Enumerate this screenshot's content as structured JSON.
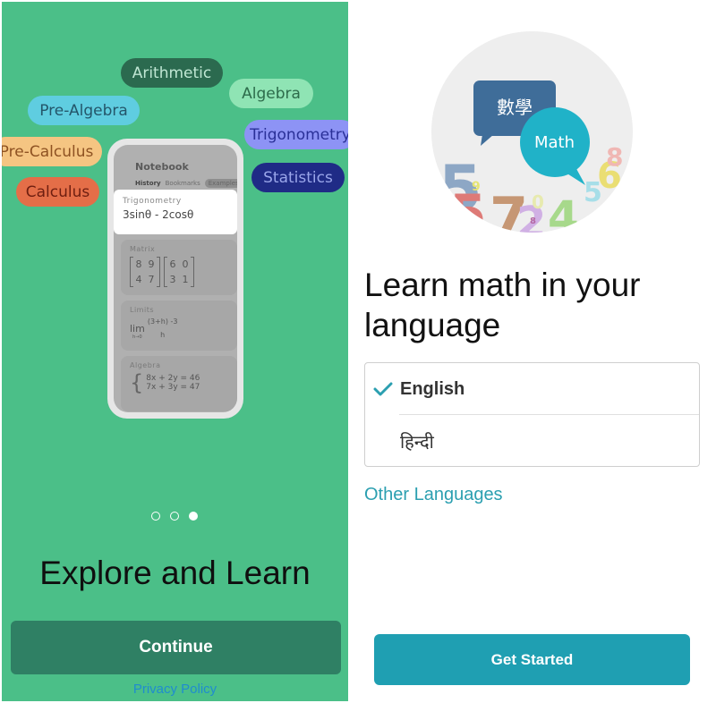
{
  "left_screen": {
    "topics": [
      {
        "label": "Arithmetic"
      },
      {
        "label": "Algebra"
      },
      {
        "label": "Pre-Algebra"
      },
      {
        "label": "Trigonometry"
      },
      {
        "label": "Pre-Calculus"
      },
      {
        "label": "Statistics"
      },
      {
        "label": "Calculus"
      }
    ],
    "notebook": {
      "title": "Notebook",
      "tabs": [
        "History",
        "Bookmarks",
        "Examples"
      ],
      "active_tab": "Examples",
      "cards": {
        "trig": {
          "label": "Trigonometry",
          "expr": "3sinθ - 2cosθ"
        },
        "matrix": {
          "label": "Matrix",
          "a": [
            "8",
            "9",
            "4",
            "7"
          ],
          "b": [
            "6",
            "0",
            "3",
            "1"
          ]
        },
        "limits": {
          "label": "Limits",
          "lim": "lim",
          "sub": "h→0",
          "num": "(3+h) -3",
          "den": "h"
        },
        "algebra": {
          "label": "Algebra",
          "eq1": "8x + 2y = 46",
          "eq2": "7x + 3y = 47"
        }
      }
    },
    "pagination": {
      "total": 3,
      "active_index": 2
    },
    "title": "Explore and Learn",
    "continue_label": "Continue",
    "privacy_label": "Privacy Policy"
  },
  "right_screen": {
    "hero": {
      "bubble_chinese": "數學",
      "bubble_math": "Math"
    },
    "title_line1": "Learn math in your",
    "title_line2": "language",
    "languages": [
      {
        "label": "English",
        "selected": true
      },
      {
        "label": "हिन्दी",
        "selected": false
      }
    ],
    "other_languages_label": "Other Languages",
    "get_started_label": "Get Started"
  },
  "colors": {
    "left_bg": "#4bbf88",
    "continue_btn": "#2f8064",
    "accent_teal": "#1f9fb2",
    "link_blue": "#1f8ccf"
  }
}
